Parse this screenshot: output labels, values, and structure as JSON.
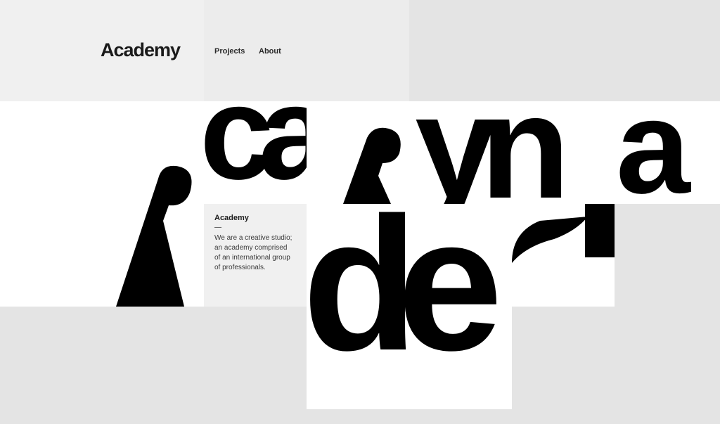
{
  "header": {
    "logo_text": "Academy",
    "nav": [
      {
        "label": "Projects"
      },
      {
        "label": "About"
      }
    ]
  },
  "card": {
    "title": "Academy",
    "dash": "—",
    "description": "We are a creative studio; an academy comprised of an international group of professionals."
  },
  "colors": {
    "page_background": "#e4e4e4",
    "tile_light": "#f0f0f0",
    "tile_white": "#ffffff",
    "glyph": "#000000"
  }
}
